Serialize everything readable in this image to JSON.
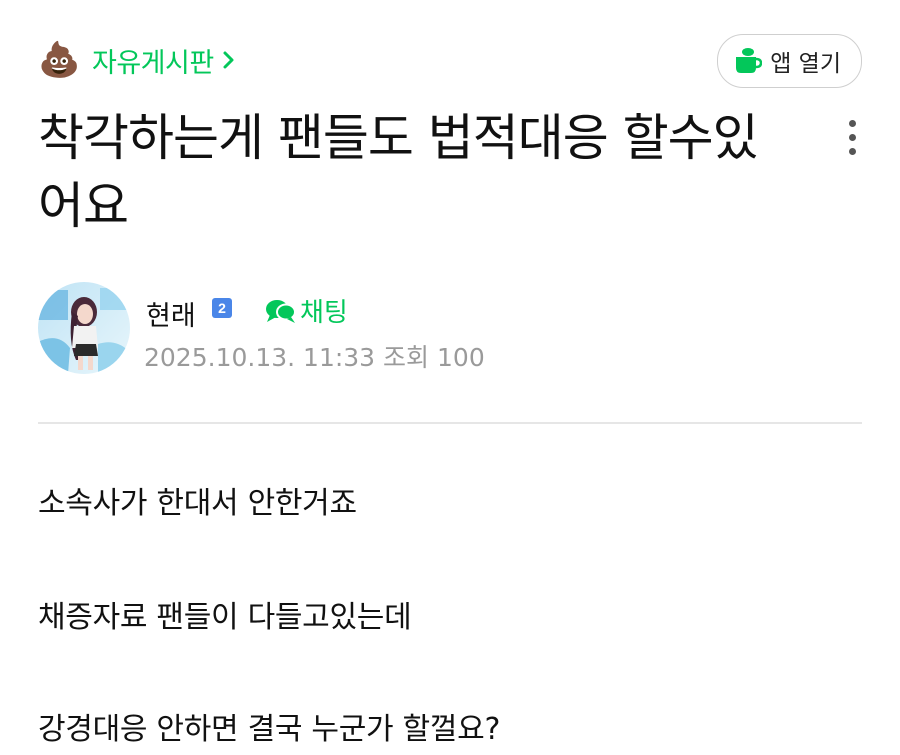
{
  "header": {
    "board_emoji": "💩",
    "board_name": "자유게시판",
    "open_app_label": "앱 열기"
  },
  "post": {
    "title": "착각하는게 팬들도 법적대응 할수있어요",
    "author": {
      "name": "현래",
      "level": "2",
      "chat_label": "채팅"
    },
    "date": "2025.10.13. 11:33",
    "views_label": "조회",
    "views": "100",
    "body": [
      "소속사가 한대서 안한거죠",
      "채증자료 팬들이 다들고있는데",
      "강경대응 안하면 결국 누군가 할껄요?"
    ]
  },
  "colors": {
    "accent_green": "#03c75a",
    "level_badge": "#4a86e8",
    "meta_gray": "#9a9a9a"
  },
  "icons": {
    "board_chevron": "chevron-right-icon",
    "open_app": "cup-icon",
    "chat": "chat-bubble-icon",
    "more": "more-vertical-icon"
  }
}
